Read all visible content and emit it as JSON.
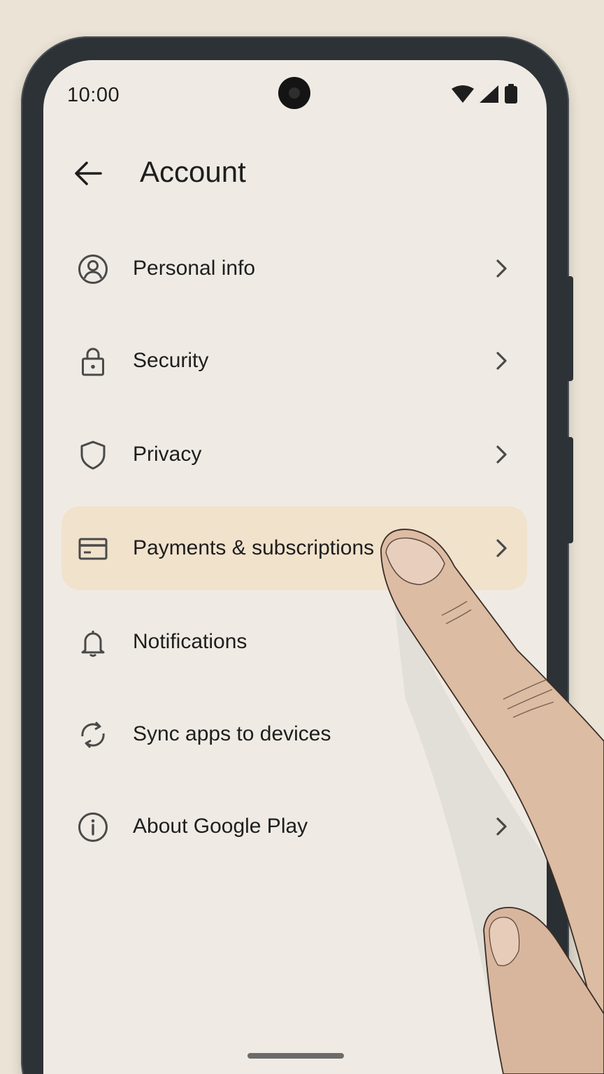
{
  "status_bar": {
    "time": "10:00",
    "icons": [
      "wifi-icon",
      "signal-icon",
      "battery-icon"
    ]
  },
  "header": {
    "title": "Account",
    "back_icon": "arrow-left-icon"
  },
  "menu": {
    "items": [
      {
        "label": "Personal info",
        "icon": "account-circle-icon",
        "has_chevron": true,
        "highlighted": false
      },
      {
        "label": "Security",
        "icon": "lock-icon",
        "has_chevron": true,
        "highlighted": false
      },
      {
        "label": "Privacy",
        "icon": "shield-icon",
        "has_chevron": true,
        "highlighted": false
      },
      {
        "label": "Payments & subscriptions",
        "icon": "credit-card-icon",
        "has_chevron": true,
        "highlighted": true
      },
      {
        "label": "Notifications",
        "icon": "bell-icon",
        "has_chevron": false,
        "highlighted": false
      },
      {
        "label": "Sync apps to devices",
        "icon": "sync-icon",
        "has_chevron": false,
        "highlighted": false
      },
      {
        "label": "About Google Play",
        "icon": "info-icon",
        "has_chevron": true,
        "highlighted": false
      }
    ]
  },
  "colors": {
    "background": "#ebe4d6",
    "screen": "#efebe4",
    "highlight": "#f1e2cc",
    "text": "#1e1e1e",
    "icon": "#4a4a4a"
  }
}
